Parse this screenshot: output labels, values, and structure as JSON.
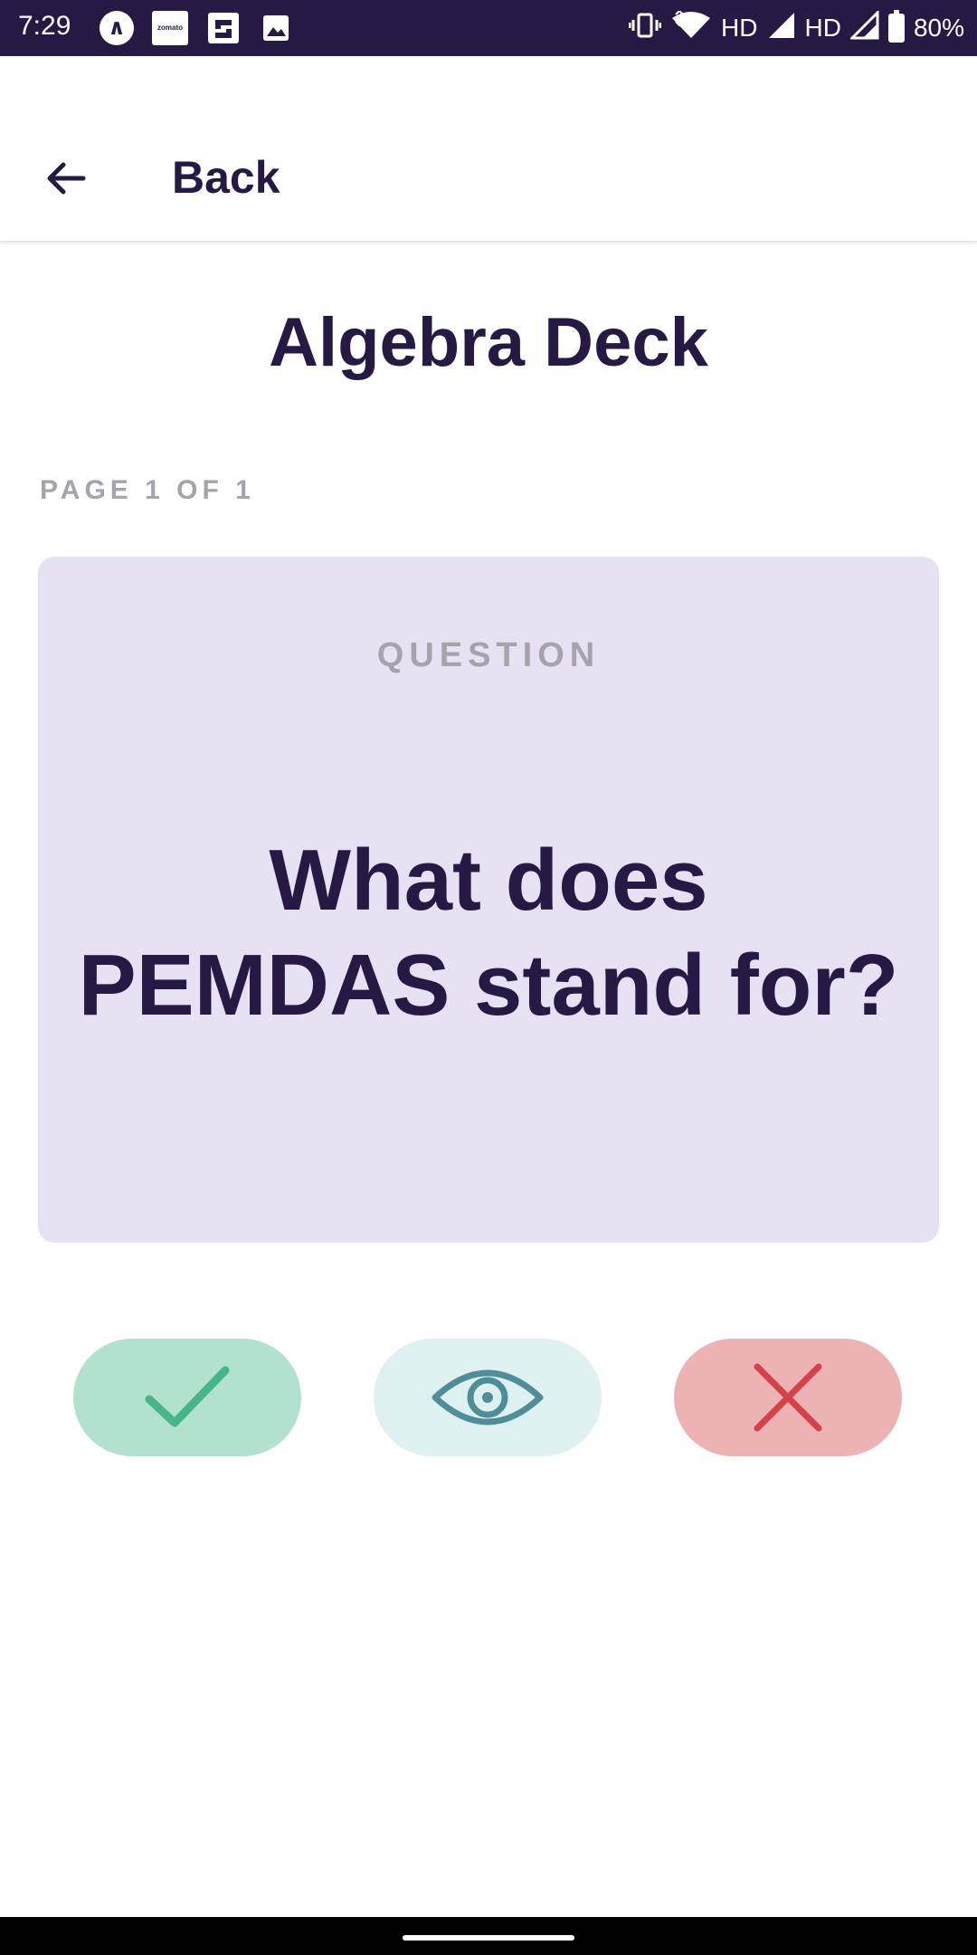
{
  "status_bar": {
    "time": "7:29",
    "network": "HD",
    "network2": "HD",
    "battery": "80%",
    "icons": [
      "app-a-icon",
      "zomato-icon",
      "sports-app-icon",
      "gallery-icon",
      "vibrate-icon",
      "wifi-icon",
      "signal-icon",
      "battery-icon"
    ],
    "notif_app2_text": "zomato"
  },
  "app_bar": {
    "back_label": "Back",
    "back_icon": "arrow-left-icon"
  },
  "deck": {
    "title": "Algebra Deck",
    "page_indicator": "PAGE 1 OF 1"
  },
  "card": {
    "label": "QUESTION",
    "text": "What does PEMDAS stand for?"
  },
  "actions": {
    "correct_icon": "checkmark-icon",
    "reveal_icon": "eye-icon",
    "wrong_icon": "x-close-icon"
  },
  "colors": {
    "primary": "#261a45",
    "card_bg": "#e6e2f3",
    "muted": "#a6a3ad",
    "correct_bg": "#b2e1d0",
    "correct_fg": "#47b58a",
    "reveal_bg": "#dff0f1",
    "reveal_fg": "#4f8e98",
    "wrong_bg": "#edb3b4",
    "wrong_fg": "#d6424a"
  }
}
